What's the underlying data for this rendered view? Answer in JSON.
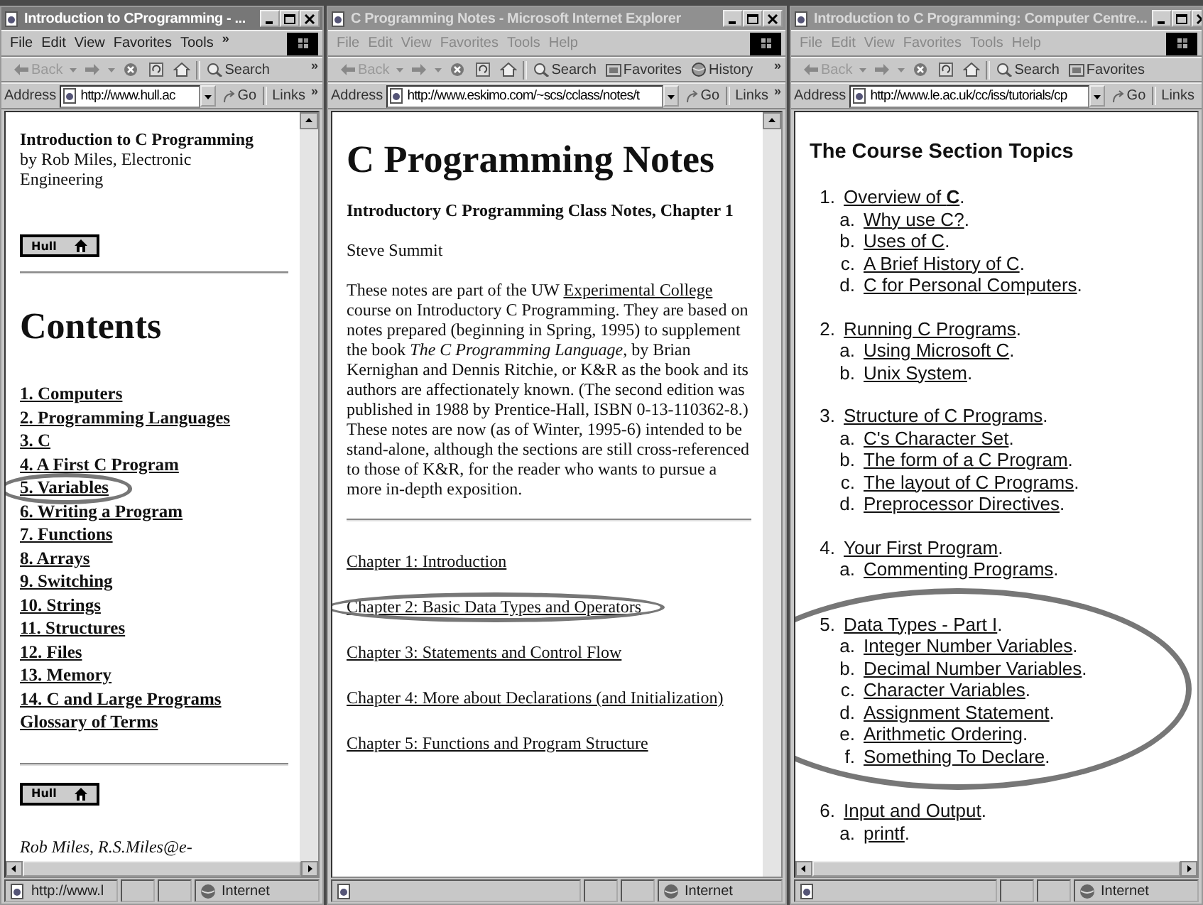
{
  "windows": [
    {
      "title": "Introduction to CProgramming - ...",
      "active": true,
      "menu": [
        "File",
        "Edit",
        "View",
        "Favorites",
        "Tools"
      ],
      "menu_overflow": "»",
      "toolbar": [
        {
          "kind": "back",
          "label": "Back"
        },
        {
          "kind": "forward"
        },
        {
          "kind": "stop"
        },
        {
          "kind": "refresh"
        },
        {
          "kind": "home"
        },
        {
          "kind": "search",
          "label": "Search"
        }
      ],
      "toolbar_overflow": "»",
      "address_label": "Address",
      "url": "http://www.hull.ac",
      "go": "Go",
      "links": "Links",
      "links_overflow": "»",
      "vertical_scrollbar": true,
      "horizontal_scrollbar": true,
      "blocks": [
        {
          "kind": "lines",
          "lines": [
            "**Introduction to C Programming**",
            "by Rob Miles, Electronic",
            "Engineering"
          ]
        },
        {
          "kind": "badge",
          "label": "Hull"
        },
        {
          "kind": "rule"
        },
        {
          "kind": "heading",
          "text": "Contents"
        },
        {
          "kind": "contents_links",
          "items": [
            {
              "text": "1. Computers"
            },
            {
              "text": "2. Programming Languages"
            },
            {
              "text": "3. C"
            },
            {
              "text": "4. A First C Program"
            },
            {
              "text": "5. Variables",
              "circled": true
            },
            {
              "text": "6. Writing a Program"
            },
            {
              "text": "7. Functions"
            },
            {
              "text": "8. Arrays"
            },
            {
              "text": "9. Switching"
            },
            {
              "text": "10. Strings"
            },
            {
              "text": "11. Structures"
            },
            {
              "text": "12. Files"
            },
            {
              "text": "13. Memory"
            },
            {
              "text": "14. C and Large Programs"
            },
            {
              "text": "Glossary of Terms"
            }
          ]
        },
        {
          "kind": "rule"
        },
        {
          "kind": "badge",
          "label": "Hull"
        },
        {
          "kind": "footer",
          "text": "Rob Miles, R.S.Miles@e-"
        }
      ],
      "status": [
        "http://www.l",
        "Internet"
      ]
    },
    {
      "title": "C Programming Notes - Microsoft Internet Explorer",
      "active": false,
      "menu": [
        "File",
        "Edit",
        "View",
        "Favorites",
        "Tools",
        "Help"
      ],
      "toolbar": [
        {
          "kind": "back",
          "label": "Back"
        },
        {
          "kind": "forward"
        },
        {
          "kind": "stop"
        },
        {
          "kind": "refresh"
        },
        {
          "kind": "home"
        },
        {
          "kind": "search",
          "label": "Search"
        },
        {
          "kind": "favorites",
          "label": "Favorites"
        },
        {
          "kind": "history",
          "label": "History"
        }
      ],
      "toolbar_overflow": "»",
      "address_label": "Address",
      "url": "http://www.eskimo.com/~scs/cclass/notes/t",
      "go": "Go",
      "links": "Links",
      "links_overflow": "»",
      "vertical_scrollbar": true,
      "blocks": [
        {
          "kind": "heading",
          "text": "C Programming Notes"
        },
        {
          "kind": "subheading",
          "text": "Introductory C Programming Class Notes, Chapter 1"
        },
        {
          "kind": "para",
          "parts": [
            {
              "kind": "text",
              "text": "Steve Summit"
            }
          ]
        },
        {
          "kind": "para",
          "parts": [
            {
              "kind": "text",
              "text": "These notes are part of the UW "
            },
            {
              "kind": "link",
              "text": "Experimental College"
            },
            {
              "kind": "text",
              "text": " course on Introductory C Programming. They are based on notes prepared (beginning in Spring, 1995) to supplement the book *The C Programming Language*, by Brian Kernighan and Dennis Ritchie, or K&R as the book and its authors are affectionately known. (The second edition was published in 1988 by Prentice-Hall, ISBN 0-13-110362-8.) These notes are now (as of Winter, 1995-6) intended to be stand-alone, although the sections are still cross-referenced to those of K&R, for the reader who wants to pursue a more in-depth exposition."
            }
          ]
        },
        {
          "kind": "rule"
        },
        {
          "kind": "chapter_links",
          "items": [
            {
              "text": "Chapter 1: Introduction"
            },
            {
              "text": "Chapter 2: Basic Data Types and Operators",
              "circled": true
            },
            {
              "text": "Chapter 3: Statements and Control Flow"
            },
            {
              "text": "Chapter 4: More about Declarations (and Initialization)"
            },
            {
              "text": "Chapter 5: Functions and Program Structure"
            }
          ]
        }
      ],
      "status": [
        "Internet"
      ]
    },
    {
      "title": "Introduction to C Programming: Computer Centre...",
      "active": false,
      "menu": [
        "File",
        "Edit",
        "View",
        "Favorites",
        "Tools",
        "Help"
      ],
      "toolbar": [
        {
          "kind": "back",
          "label": "Back"
        },
        {
          "kind": "forward"
        },
        {
          "kind": "stop"
        },
        {
          "kind": "refresh"
        },
        {
          "kind": "home"
        },
        {
          "kind": "search",
          "label": "Search"
        },
        {
          "kind": "favorites",
          "label": "Favorites"
        }
      ],
      "address_label": "Address",
      "url": "http://www.le.ac.uk/cc/iss/tutorials/cp",
      "go": "Go",
      "links": "Links",
      "horizontal_scrollbar": true,
      "blocks": [
        {
          "kind": "sans_heading",
          "text": "The Course Section Topics"
        },
        {
          "kind": "outline",
          "items": [
            {
              "marker": "1.",
              "text": "Overview of **C**",
              "suffix": ".",
              "children": [
                {
                  "marker": "a.",
                  "text": "Why use C?",
                  "suffix": "."
                },
                {
                  "marker": "b.",
                  "text": "Uses of C",
                  "suffix": "."
                },
                {
                  "marker": "c.",
                  "text": "A Brief History of C",
                  "suffix": "."
                },
                {
                  "marker": "d.",
                  "text": "C for Personal Computers",
                  "suffix": "."
                }
              ]
            },
            {
              "marker": "2.",
              "text": "Running C Programs",
              "suffix": ".",
              "children": [
                {
                  "marker": "a.",
                  "text": "Using Microsoft C",
                  "suffix": "."
                },
                {
                  "marker": "b.",
                  "text": "Unix System",
                  "suffix": "."
                }
              ]
            },
            {
              "marker": "3.",
              "text": "Structure of C Programs",
              "suffix": ".",
              "children": [
                {
                  "marker": "a.",
                  "text": "C's Character Set",
                  "suffix": "."
                },
                {
                  "marker": "b.",
                  "text": "The form of a C Program",
                  "suffix": "."
                },
                {
                  "marker": "c.",
                  "text": "The layout of C Programs",
                  "suffix": "."
                },
                {
                  "marker": "d.",
                  "text": "Preprocessor Directives",
                  "suffix": "."
                }
              ]
            },
            {
              "marker": "4.",
              "text": "Your First Program",
              "suffix": ".",
              "children": [
                {
                  "marker": "a.",
                  "text": "Commenting Programs",
                  "suffix": "."
                }
              ]
            },
            {
              "marker": "5.",
              "text": "Data Types - Part I",
              "suffix": ".",
              "circled": true,
              "children": [
                {
                  "marker": "a.",
                  "text": "Integer Number Variables",
                  "suffix": "."
                },
                {
                  "marker": "b.",
                  "text": "Decimal Number Variables",
                  "suffix": "."
                },
                {
                  "marker": "c.",
                  "text": "Character Variables",
                  "suffix": "."
                },
                {
                  "marker": "d.",
                  "text": "Assignment Statement",
                  "suffix": "."
                },
                {
                  "marker": "e.",
                  "text": "Arithmetic Ordering",
                  "suffix": "."
                },
                {
                  "marker": "f.",
                  "text": "Something To Declare",
                  "suffix": "."
                }
              ]
            },
            {
              "marker": "6.",
              "text": "Input and Output",
              "suffix": ".",
              "children": [
                {
                  "marker": "a.",
                  "text": "printf",
                  "suffix": "."
                }
              ]
            }
          ]
        }
      ],
      "status": [
        "Internet"
      ]
    }
  ]
}
